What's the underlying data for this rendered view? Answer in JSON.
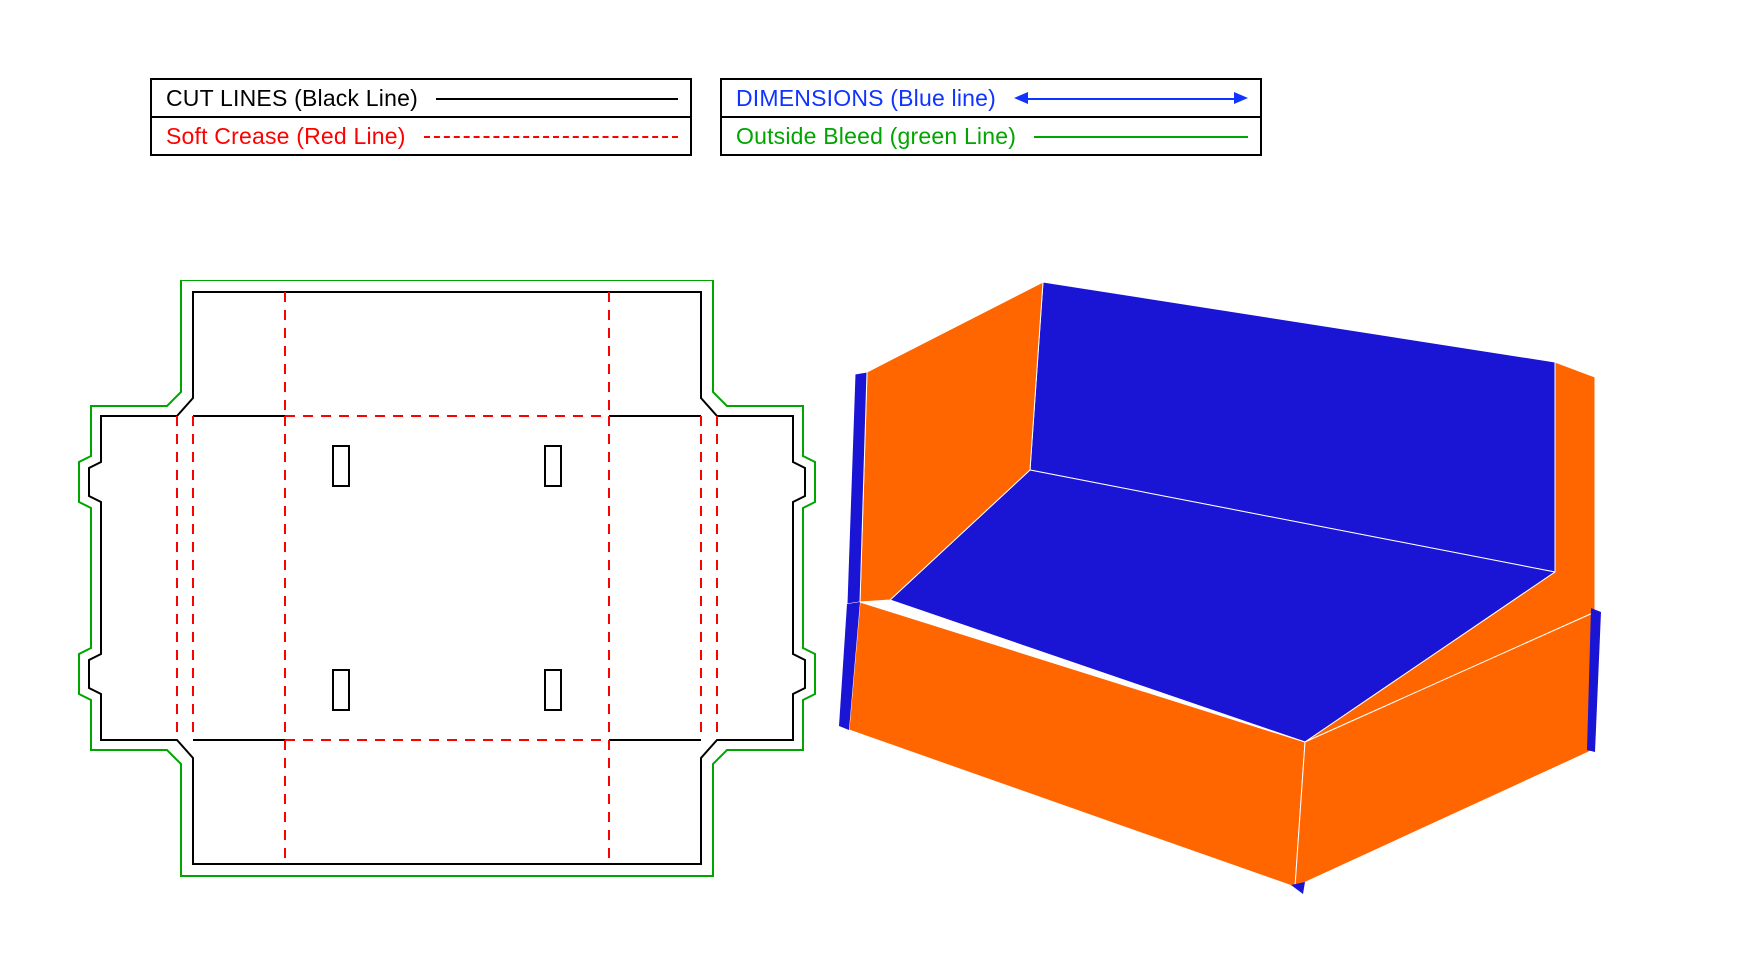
{
  "legend": {
    "left": [
      {
        "label": "CUT LINES (Black Line)",
        "colorClass": "txt-black"
      },
      {
        "label": "Soft Crease (Red Line)",
        "colorClass": "txt-red"
      }
    ],
    "right": [
      {
        "label": "DIMENSIONS (Blue line)",
        "colorClass": "txt-blue"
      },
      {
        "label": "Outside Bleed (green Line)",
        "colorClass": "txt-green"
      }
    ]
  },
  "dieline": {
    "description": "Flat packaging dieline for open tray box",
    "line_types": {
      "cut": {
        "color": "#000000",
        "style": "solid"
      },
      "crease": {
        "color": "#ff0000",
        "style": "dashed"
      },
      "bleed": {
        "color": "#00a500",
        "style": "solid"
      }
    }
  },
  "render": {
    "description": "3D assembled open tray box",
    "outer_color": "#ff6600",
    "inner_color": "#1a14d4"
  }
}
